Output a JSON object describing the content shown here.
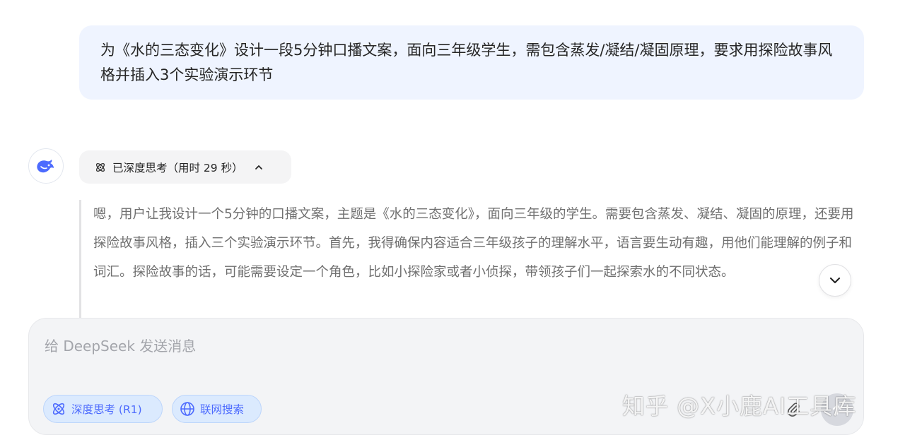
{
  "user_message": {
    "text": "为《水的三态变化》设计一段5分钟口播文案，面向三年级学生，需包含蒸发/凝结/凝固原理，要求用探险故事风格并插入3个实验演示环节"
  },
  "assistant": {
    "avatar_icon": "deepseek-whale-icon",
    "thinking_toggle": {
      "label": "已深度思考（用时 29 秒）",
      "icon": "atom-icon",
      "chevron": "chevron-up-icon"
    },
    "thought_text": "嗯，用户让我设计一个5分钟的口播文案，主题是《水的三态变化》，面向三年级的学生。需要包含蒸发、凝结、凝固的原理，还要用探险故事风格，插入三个实验演示环节。首先，我得确保内容适合三年级孩子的理解水平，语言要生动有趣，用他们能理解的例子和词汇。探险故事的话，可能需要设定一个角色，比如小探险家或者小侦探，带领孩子们一起探索水的不同状态。"
  },
  "scroll_down": {
    "icon": "chevron-down-icon"
  },
  "composer": {
    "placeholder": "给 DeepSeek 发送消息",
    "deep_think_label": "深度思考 (R1)",
    "web_search_label": "联网搜索",
    "attach_icon": "paperclip-icon",
    "send_icon": "arrow-up-icon"
  },
  "watermark": {
    "text": "知乎 @X小鹿AI工具库"
  },
  "colors": {
    "accent": "#4d6bfe",
    "user_bubble": "#eff4ff",
    "pill_bg": "#dbeafe",
    "composer_bg": "#f3f4f6"
  }
}
